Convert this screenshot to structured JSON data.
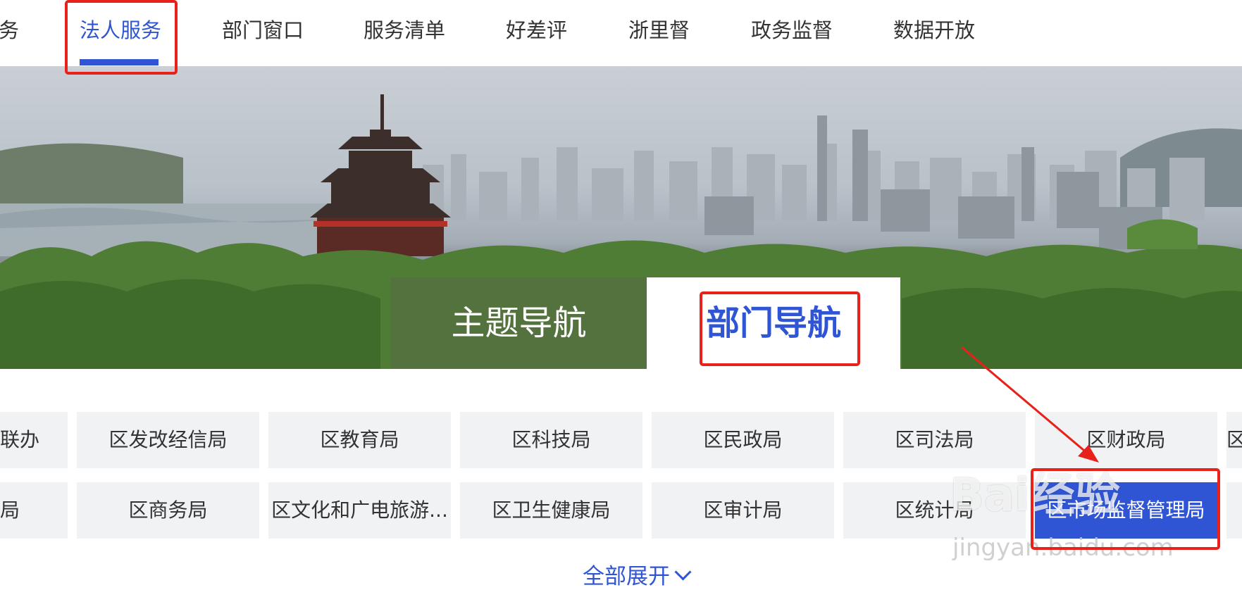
{
  "nav": {
    "items": [
      "务",
      "法人服务",
      "部门窗口",
      "服务清单",
      "好差评",
      "浙里督",
      "政务监督",
      "数据开放"
    ],
    "active": "法人服务"
  },
  "tabs": {
    "theme": "主题导航",
    "dept": "部门导航"
  },
  "departments": {
    "row1": [
      "联办",
      "区发改经信局",
      "区教育局",
      "区科技局",
      "区民政局",
      "区司法局",
      "区财政局",
      "区"
    ],
    "row2": [
      "局",
      "区商务局",
      "区文化和广电旅游...",
      "区卫生健康局",
      "区审计局",
      "区统计局",
      "区市场监督管理局",
      ""
    ]
  },
  "expand_label": "全部展开",
  "watermark": {
    "brand": "Bai经验",
    "url": "jingyan.baidu.com"
  },
  "colors": {
    "accent": "#2f55d4",
    "annotation": "#e8211a",
    "cell_bg": "#f1f2f4"
  }
}
